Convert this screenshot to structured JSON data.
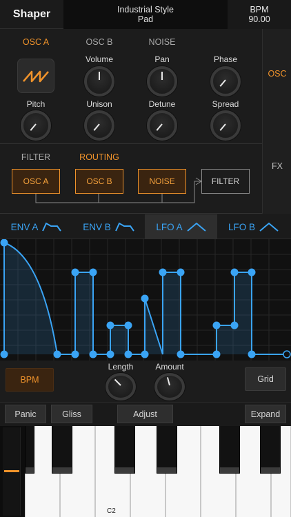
{
  "header": {
    "app_title": "Shaper",
    "preset_line1": "Industrial Style",
    "preset_line2": "Pad",
    "bpm_label": "BPM",
    "bpm_value": "90.00"
  },
  "side_tabs": {
    "osc": "OSC",
    "fx": "FX"
  },
  "osc": {
    "tabs": [
      "OSC A",
      "OSC B",
      "NOISE"
    ],
    "knobs": [
      "Volume",
      "Pan",
      "Phase",
      "Pitch",
      "Unison",
      "Detune",
      "Spread"
    ]
  },
  "routing": {
    "tabs": [
      "FILTER",
      "ROUTING"
    ],
    "boxes": [
      "OSC A",
      "OSC B",
      "NOISE",
      "FILTER"
    ]
  },
  "mod_tabs": [
    "ENV A",
    "ENV B",
    "LFO A",
    "LFO B"
  ],
  "lower": {
    "bpm_button": "BPM",
    "length_label": "Length",
    "amount_label": "Amount",
    "grid_button": "Grid"
  },
  "keyboard": {
    "panic": "Panic",
    "gliss": "Gliss",
    "adjust": "Adjust",
    "expand": "Expand",
    "c2_label": "C2"
  },
  "colors": {
    "accent_orange": "#f0932b",
    "accent_blue": "#3aa4f5"
  }
}
